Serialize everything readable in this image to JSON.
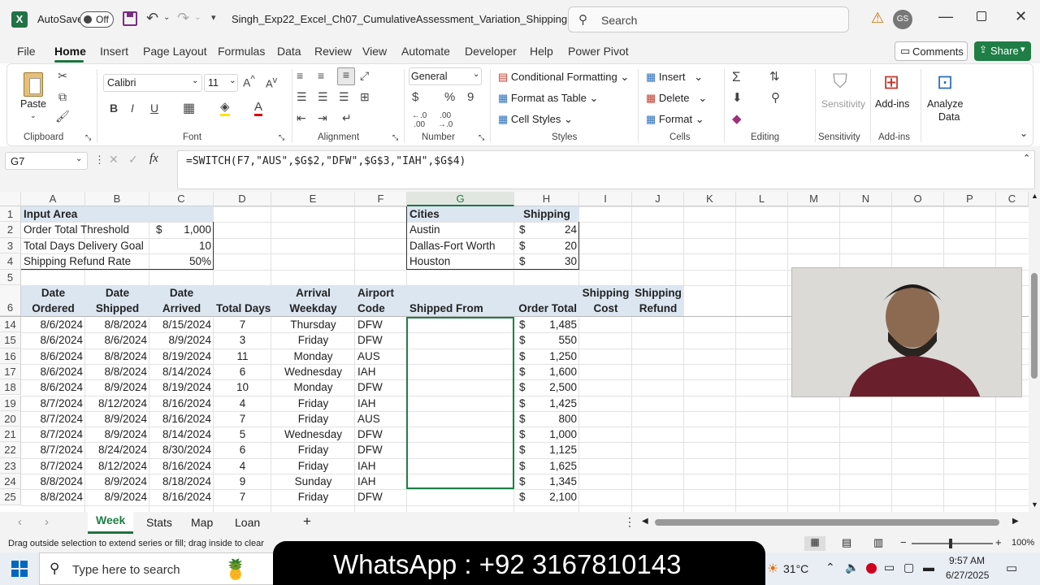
{
  "titlebar": {
    "autosave_label": "AutoSave",
    "autosave_state": "Off",
    "filename": "Singh_Exp22_Excel_Ch07_CumulativeAssessment_Variation_Shipping  -...",
    "search_placeholder": "Search",
    "user_initials": "GS"
  },
  "menu_tabs": [
    "File",
    "Home",
    "Insert",
    "Page Layout",
    "Formulas",
    "Data",
    "Review",
    "View",
    "Automate",
    "Developer",
    "Help",
    "Power Pivot"
  ],
  "active_tab": "Home",
  "comments_label": "Comments",
  "share_label": "Share",
  "ribbon": {
    "paste": "Paste",
    "font_name": "Calibri",
    "font_size": "11",
    "number_format": "General",
    "conditional_formatting": "Conditional Formatting",
    "format_as_table": "Format as Table",
    "cell_styles": "Cell Styles",
    "insert": "Insert",
    "delete": "Delete",
    "format": "Format",
    "sensitivity": "Sensitivity",
    "addins": "Add-ins",
    "analyze_data_1": "Analyze",
    "analyze_data_2": "Data",
    "groups": {
      "clipboard": "Clipboard",
      "font": "Font",
      "alignment": "Alignment",
      "number": "Number",
      "styles": "Styles",
      "cells": "Cells",
      "editing": "Editing",
      "sensitivity": "Sensitivity",
      "addins": "Add-ins"
    }
  },
  "formula": {
    "name_box": "G7",
    "text": "=SWITCH(F7,\"AUS\",$G$2,\"DFW\",$G$3,\"IAH\",$G$4)"
  },
  "columns": [
    "A",
    "B",
    "C",
    "D",
    "E",
    "F",
    "G",
    "H",
    "I",
    "J",
    "K",
    "L",
    "M",
    "N",
    "O",
    "P",
    "C"
  ],
  "input_area": {
    "title": "Input Area",
    "rows": [
      {
        "label": "Order Total Threshold",
        "cur": "$",
        "value": "1,000"
      },
      {
        "label": "Total Days Delivery Goal",
        "cur": "",
        "value": "10"
      },
      {
        "label": "Shipping Refund Rate",
        "cur": "",
        "value": "50%"
      }
    ]
  },
  "cities_table": {
    "h1": "Cities",
    "h2": "Shipping",
    "rows": [
      {
        "city": "Austin",
        "cur": "$",
        "value": "24"
      },
      {
        "city": "Dallas-Fort Worth",
        "cur": "$",
        "value": "20"
      },
      {
        "city": "Houston",
        "cur": "$",
        "value": "30"
      }
    ]
  },
  "row_numbers": {
    "r1": "1",
    "r2": "2",
    "r3": "3",
    "r4": "4",
    "r5": "5",
    "r6": "6"
  },
  "headers": {
    "a_1": "Date",
    "a_2": "Ordered",
    "b_1": "Date",
    "b_2": "Shipped",
    "c_1": "Date",
    "c_2": "Arrived",
    "d": "Total Days",
    "e_1": "Arrival",
    "e_2": "Weekday",
    "f_1": "Airport",
    "f_2": "Code",
    "g": "Shipped From",
    "h": "Order Total",
    "i_1": "Shipping",
    "i_2": "Cost",
    "j_1": "Shipping",
    "j_2": "Refund"
  },
  "data_rows": [
    {
      "row": "14",
      "a": "8/6/2024",
      "b": "8/8/2024",
      "c": "8/15/2024",
      "d": "7",
      "e": "Thursday",
      "f": "DFW",
      "h": "1,485"
    },
    {
      "row": "15",
      "a": "8/6/2024",
      "b": "8/6/2024",
      "c": "8/9/2024",
      "d": "3",
      "e": "Friday",
      "f": "DFW",
      "h": "550"
    },
    {
      "row": "16",
      "a": "8/6/2024",
      "b": "8/8/2024",
      "c": "8/19/2024",
      "d": "11",
      "e": "Monday",
      "f": "AUS",
      "h": "1,250"
    },
    {
      "row": "17",
      "a": "8/6/2024",
      "b": "8/8/2024",
      "c": "8/14/2024",
      "d": "6",
      "e": "Wednesday",
      "f": "IAH",
      "h": "1,600"
    },
    {
      "row": "18",
      "a": "8/6/2024",
      "b": "8/9/2024",
      "c": "8/19/2024",
      "d": "10",
      "e": "Monday",
      "f": "DFW",
      "h": "2,500"
    },
    {
      "row": "19",
      "a": "8/7/2024",
      "b": "8/12/2024",
      "c": "8/16/2024",
      "d": "4",
      "e": "Friday",
      "f": "IAH",
      "h": "1,425"
    },
    {
      "row": "20",
      "a": "8/7/2024",
      "b": "8/9/2024",
      "c": "8/16/2024",
      "d": "7",
      "e": "Friday",
      "f": "AUS",
      "h": "800"
    },
    {
      "row": "21",
      "a": "8/7/2024",
      "b": "8/9/2024",
      "c": "8/14/2024",
      "d": "5",
      "e": "Wednesday",
      "f": "DFW",
      "h": "1,000"
    },
    {
      "row": "22",
      "a": "8/7/2024",
      "b": "8/24/2024",
      "c": "8/30/2024",
      "d": "6",
      "e": "Friday",
      "f": "DFW",
      "h": "1,125"
    },
    {
      "row": "23",
      "a": "8/7/2024",
      "b": "8/12/2024",
      "c": "8/16/2024",
      "d": "4",
      "e": "Friday",
      "f": "IAH",
      "h": "1,625"
    },
    {
      "row": "24",
      "a": "8/8/2024",
      "b": "8/9/2024",
      "c": "8/18/2024",
      "d": "9",
      "e": "Sunday",
      "f": "IAH",
      "h": "1,345"
    },
    {
      "row": "25",
      "a": "8/8/2024",
      "b": "8/9/2024",
      "c": "8/16/2024",
      "d": "7",
      "e": "Friday",
      "f": "DFW",
      "h": "2,100"
    }
  ],
  "currency_symbol": "$",
  "sheet_tabs": [
    "Week",
    "Stats",
    "Map",
    "Loan"
  ],
  "active_sheet": "Week",
  "status_text": "Drag outside selection to extend series or fill; drag inside to clear",
  "zoom": "100%",
  "taskbar": {
    "search_placeholder": "Type here to search",
    "overlay_text": "WhatsApp : +92 3167810143",
    "temperature": "31°C",
    "time": "9:57 AM",
    "date": "6/27/2025"
  },
  "colors": {
    "excel_green": "#217346",
    "share_green": "#1e7e45",
    "header_fill": "#dbe6f1",
    "selection": "#1e7e45"
  }
}
